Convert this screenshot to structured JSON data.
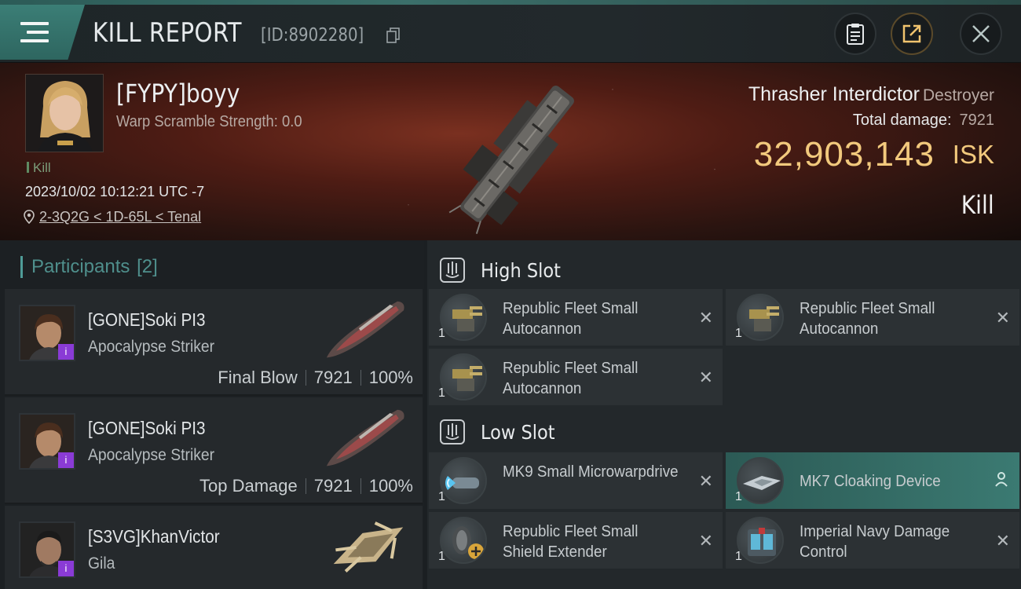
{
  "header": {
    "title": "KILL REPORT",
    "report_id": "[ID:8902280]"
  },
  "victim": {
    "name": "[FYPY]boyy",
    "scramble": "Warp Scramble Strength: 0.0",
    "kill_tag": "Kill",
    "datetime": "2023/10/02 10:12:21 UTC -7",
    "location": "2-3Q2G < 1D-65L < Tenal",
    "ship_name": "Thrasher Interdictor",
    "ship_class": "Destroyer",
    "total_damage_label": "Total damage:",
    "total_damage_value": "7921",
    "isk_value": "32,903,143",
    "isk_unit": "ISK",
    "result": "Kill"
  },
  "participants": {
    "label": "Participants",
    "count": "[2]",
    "rows": [
      {
        "name": "[GONE]Soki PI3",
        "ship": "Apocalypse Striker",
        "role": "Final Blow",
        "damage": "7921",
        "percent": "100%",
        "badge": "i"
      },
      {
        "name": "[GONE]Soki PI3",
        "ship": "Apocalypse Striker",
        "role": "Top Damage",
        "damage": "7921",
        "percent": "100%",
        "badge": "i"
      },
      {
        "name": "[S3VG]KhanVictor",
        "ship": "Gila",
        "badge": "i"
      }
    ]
  },
  "fitting": {
    "high_slot_label": "High Slot",
    "low_slot_label": "Low Slot",
    "high": [
      {
        "name": "Republic Fleet Small Autocannon",
        "qty": "1",
        "icon": "autocannon-icon"
      },
      {
        "name": "Republic Fleet Small Autocannon",
        "qty": "1",
        "icon": "autocannon-icon"
      },
      {
        "name": "Republic Fleet Small Autocannon",
        "qty": "1",
        "icon": "autocannon-icon"
      }
    ],
    "low": [
      {
        "name": "MK9 Small Microwarpdrive",
        "qty": "1",
        "icon": "microwarpdrive-icon"
      },
      {
        "name": "MK7 Cloaking Device",
        "qty": "1",
        "icon": "cloaking-device-icon"
      },
      {
        "name": "Republic Fleet Small Shield Extender",
        "qty": "1",
        "icon": "shield-extender-icon"
      },
      {
        "name": "Imperial Navy Damage Control",
        "qty": "1",
        "icon": "damage-control-icon"
      }
    ]
  },
  "colors": {
    "accent": "#3b7e76",
    "isk": "#f2c97d",
    "badge": "#8a3bd6"
  }
}
